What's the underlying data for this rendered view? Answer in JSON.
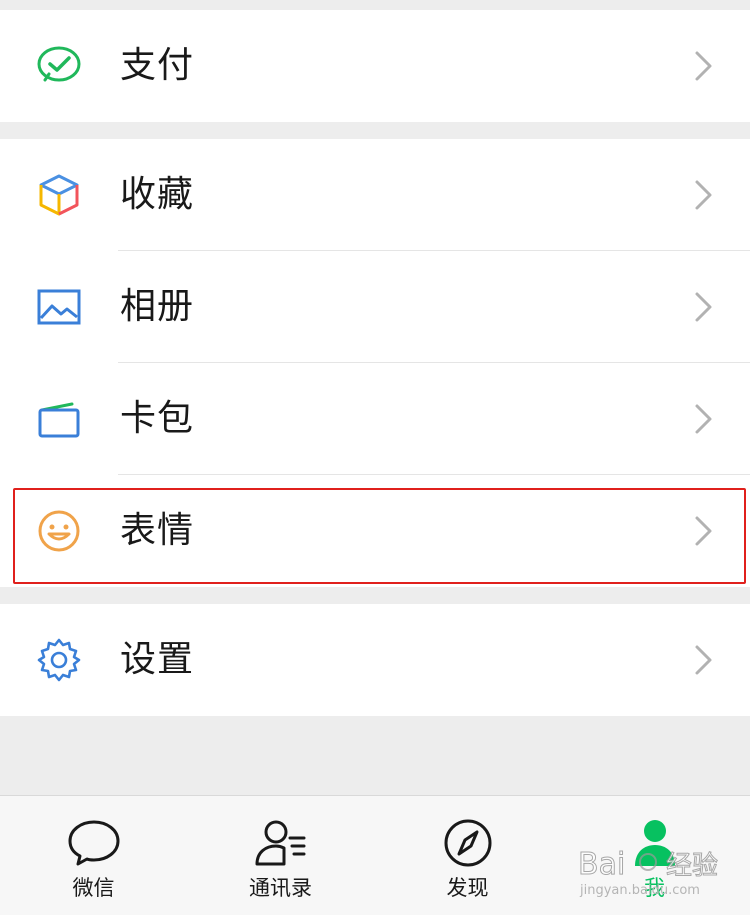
{
  "groups": {
    "pay": {
      "label": "支付"
    },
    "favorites": {
      "label": "收藏"
    },
    "album": {
      "label": "相册"
    },
    "cards": {
      "label": "卡包"
    },
    "stickers": {
      "label": "表情"
    },
    "settings": {
      "label": "设置"
    }
  },
  "tabbar": {
    "tabs": [
      {
        "label": "微信",
        "icon": "chat-bubble-icon"
      },
      {
        "label": "通讯录",
        "icon": "contacts-icon"
      },
      {
        "label": "发现",
        "icon": "compass-icon"
      },
      {
        "label": "我",
        "icon": "person-icon",
        "active": true
      }
    ]
  },
  "colors": {
    "accent": "#07c160",
    "highlight_border": "#e0201c",
    "background": "#ededed"
  },
  "watermark": {
    "text": "Bai 经验",
    "subtext": "jingyan.baidu.com"
  }
}
